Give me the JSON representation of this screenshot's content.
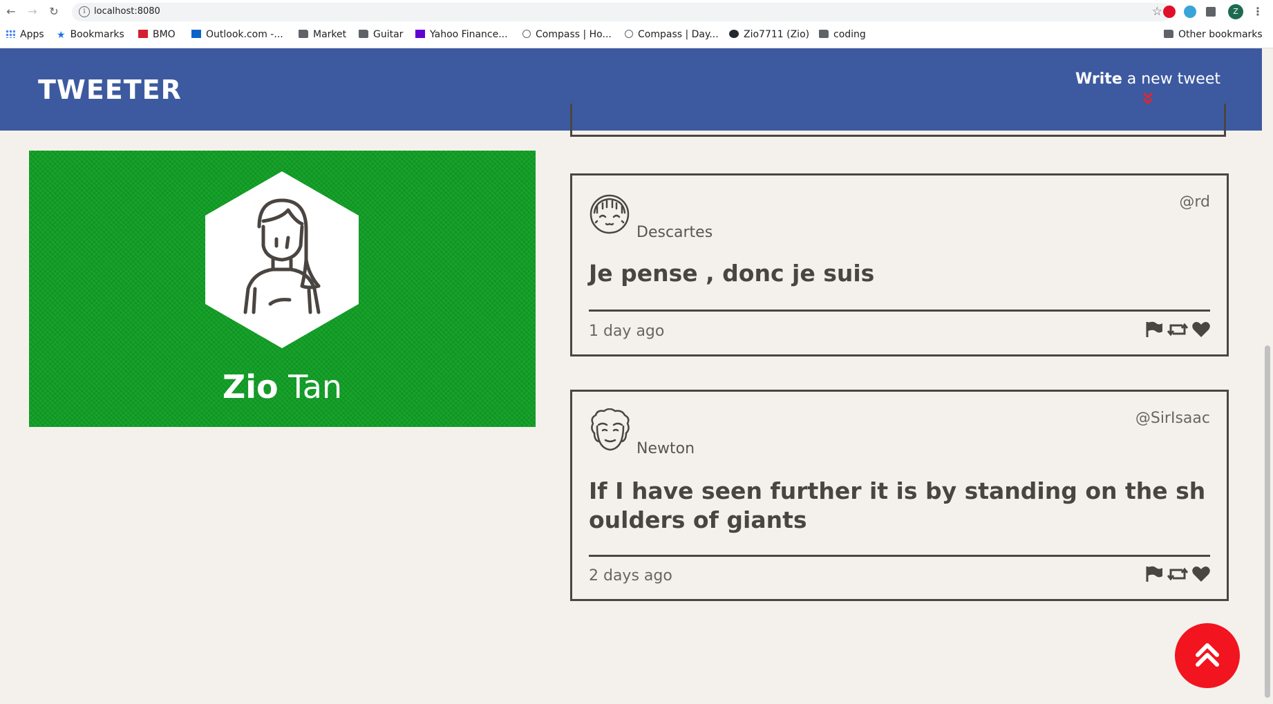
{
  "browser": {
    "url": "localhost:8080",
    "bookmarks": [
      {
        "label": "Apps",
        "icon": "apps-grid-icon"
      },
      {
        "label": "Bookmarks",
        "icon": "star-icon"
      },
      {
        "label": "BMO",
        "icon": "bmo-icon"
      },
      {
        "label": "Outlook.com -...",
        "icon": "outlook-icon"
      },
      {
        "label": "Market",
        "icon": "folder-icon"
      },
      {
        "label": "Guitar",
        "icon": "folder-icon"
      },
      {
        "label": "Yahoo Finance...",
        "icon": "yahoo-icon"
      },
      {
        "label": "Compass | Ho...",
        "icon": "globe-icon"
      },
      {
        "label": "Compass | Day...",
        "icon": "globe-icon"
      },
      {
        "label": "Zio7711 (Zio)",
        "icon": "github-icon"
      },
      {
        "label": "coding",
        "icon": "folder-icon"
      }
    ],
    "other_bookmarks": "Other bookmarks",
    "profile_initial": "Z"
  },
  "header": {
    "brand": "TWEETER",
    "compose_bold": "Write",
    "compose_rest": " a new tweet"
  },
  "profile": {
    "first_name": "Zio",
    "last_name": " Tan"
  },
  "tweets": [
    {
      "name": "Descartes",
      "handle": "@rd",
      "content": "Je pense , donc je suis",
      "time": "1 day ago"
    },
    {
      "name": "Newton",
      "handle": "@SirIsaac",
      "content": "If I have seen further it is by standing on the shoulders of giants",
      "time": "2 days ago"
    }
  ],
  "colors": {
    "header_bg": "#3d5aa0",
    "profile_bg": "#16a42a",
    "page_bg": "#f4f1ec",
    "accent_red": "#f2141e",
    "text_dark": "#4a4541"
  }
}
